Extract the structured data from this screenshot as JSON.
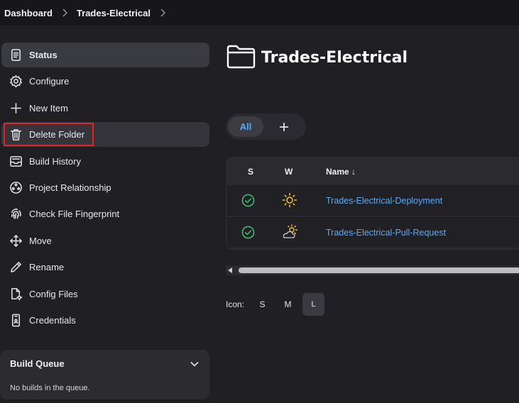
{
  "breadcrumb": {
    "items": [
      "Dashboard",
      "Trades-Electrical"
    ]
  },
  "sidebar": {
    "items": [
      {
        "label": "Status",
        "icon": "status-icon"
      },
      {
        "label": "Configure",
        "icon": "gear-icon"
      },
      {
        "label": "New Item",
        "icon": "plus-icon"
      },
      {
        "label": "Delete Folder",
        "icon": "trash-icon"
      },
      {
        "label": "Build History",
        "icon": "inbox-icon"
      },
      {
        "label": "Project Relationship",
        "icon": "relationship-icon"
      },
      {
        "label": "Check File Fingerprint",
        "icon": "fingerprint-icon"
      },
      {
        "label": "Move",
        "icon": "move-icon"
      },
      {
        "label": "Rename",
        "icon": "pencil-icon"
      },
      {
        "label": "Config Files",
        "icon": "config-file-icon"
      },
      {
        "label": "Credentials",
        "icon": "phone-credentials-icon"
      }
    ]
  },
  "queue": {
    "title": "Build Queue",
    "message": "No builds in the queue."
  },
  "main": {
    "title": "Trades-Electrical",
    "tabs": {
      "all": "All"
    },
    "table": {
      "headers": {
        "s": "S",
        "w": "W",
        "name": "Name ↓"
      },
      "rows": [
        {
          "name": "Trades-Electrical-Deployment",
          "status": "success",
          "weather": "sunny"
        },
        {
          "name": "Trades-Electrical-Pull-Request",
          "status": "success",
          "weather": "partly-cloudy"
        }
      ]
    },
    "icon_size": {
      "label": "Icon:",
      "options": [
        "S",
        "M",
        "L"
      ],
      "selected": "L"
    }
  },
  "colors": {
    "accent": "#5aa9f5",
    "success": "#3cc46a",
    "highlight": "#e0242b",
    "weather": "#f2c230"
  }
}
